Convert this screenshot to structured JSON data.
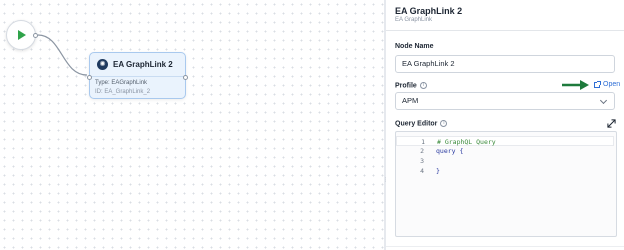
{
  "canvas": {
    "start_node": {
      "icon": "play-icon"
    },
    "node": {
      "title": "EA GraphLink 2",
      "icon": "graphlink-icon",
      "type_line": "Type: EAGraphLink",
      "id_line": "ID: EA_GraphLink_2"
    }
  },
  "panel": {
    "title": "EA GraphLink 2",
    "subtitle": "EA GraphLink",
    "node_name": {
      "label": "Node Name",
      "value": "EA GraphLink 2"
    },
    "profile": {
      "label": "Profile",
      "selected": "APM",
      "open_label": "Open"
    },
    "query_editor": {
      "label": "Query Editor",
      "lines": [
        {
          "number": "1",
          "text": "# GraphQL Query",
          "kind": "comment"
        },
        {
          "number": "2",
          "text": "query {",
          "kind": "keyword"
        },
        {
          "number": "3",
          "text": "",
          "kind": "plain"
        },
        {
          "number": "4",
          "text": "}",
          "kind": "punc"
        }
      ]
    }
  },
  "colors": {
    "play": "#2fa34a",
    "node_bg": "#eaf3fd",
    "node_border": "#a9c9ee",
    "link": "#2f6fd6",
    "arrow": "#1e7a3c"
  }
}
